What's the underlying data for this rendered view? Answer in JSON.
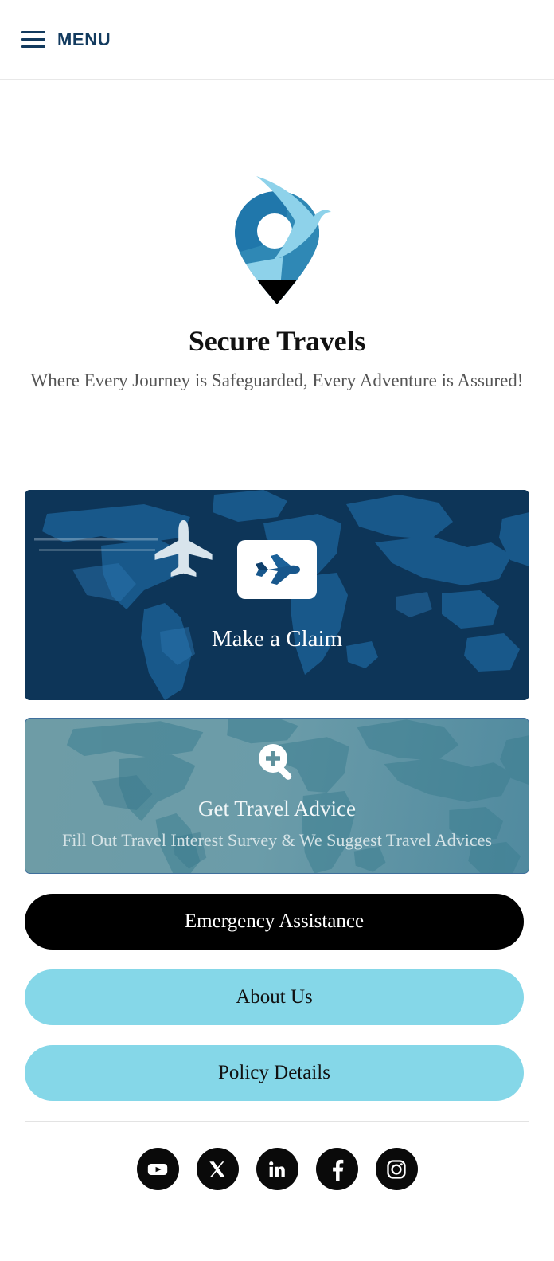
{
  "header": {
    "menu_label": "MENU",
    "menu_icon": "hamburger-icon",
    "accent_color": "#123a5e"
  },
  "brand": {
    "logo_icon": "location-pin-bird-logo",
    "title": "Secure Travels",
    "tagline": "Where Every Journey is Safeguarded, Every Adventure is Assured!",
    "logo_colors": {
      "pin_dark_blue": "#1f6fa5",
      "pin_mid_blue": "#2b85b8",
      "bird_light_blue": "#8cd0e8",
      "pin_tip_black": "#000000"
    }
  },
  "cards": [
    {
      "id": "make-a-claim",
      "icon": "airplane-icon",
      "title": "Make a Claim",
      "subtitle": "",
      "background_color": "#0d3558",
      "background_image": "world-map-dark-navy-with-airplane"
    },
    {
      "id": "get-travel-advice",
      "icon": "zoom-in-magnifier-icon",
      "title": "Get Travel Advice",
      "subtitle": "Fill Out Travel Interest Survey & We Suggest Travel Advices",
      "background_color": "#6b9ca9",
      "background_image": "world-map-teal"
    }
  ],
  "buttons": [
    {
      "id": "emergency-assistance",
      "label": "Emergency Assistance",
      "style": "dark",
      "background_color": "#000000",
      "text_color": "#ffffff"
    },
    {
      "id": "about-us",
      "label": "About Us",
      "style": "light",
      "background_color": "#85d7e8",
      "text_color": "#111111"
    },
    {
      "id": "policy-details",
      "label": "Policy Details",
      "style": "light",
      "background_color": "#85d7e8",
      "text_color": "#111111"
    }
  ],
  "footer": {
    "social": [
      {
        "id": "youtube",
        "icon": "youtube-icon",
        "label": "YouTube"
      },
      {
        "id": "x-twitter",
        "icon": "x-twitter-icon",
        "label": "X"
      },
      {
        "id": "linkedin",
        "icon": "linkedin-icon",
        "label": "LinkedIn"
      },
      {
        "id": "facebook",
        "icon": "facebook-icon",
        "label": "Facebook"
      },
      {
        "id": "instagram",
        "icon": "instagram-icon",
        "label": "Instagram"
      }
    ],
    "icon_color": "#0a0a0a"
  }
}
